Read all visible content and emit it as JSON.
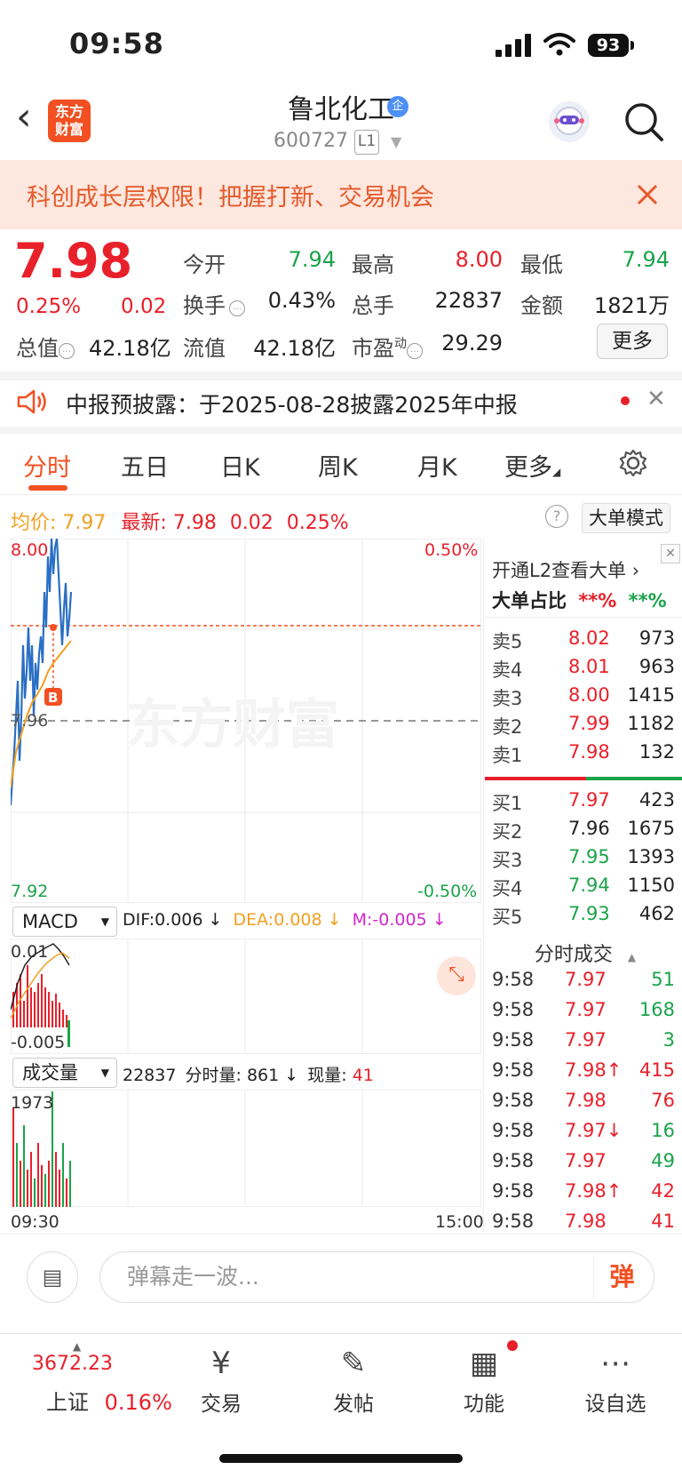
{
  "status_bar": {
    "time": "09:58",
    "battery": "93"
  },
  "header": {
    "logo_text": "东方财富",
    "stock_name": "鲁北化工",
    "badge": "企",
    "stock_code": "600727",
    "level_badge": "L1"
  },
  "banner": {
    "text": "科创成长层权限！把握打新、交易机会"
  },
  "quote": {
    "price": "7.98",
    "change_pct": "0.25%",
    "change": "0.02",
    "labels": {
      "open": "今开",
      "high": "最高",
      "low": "最低",
      "turnover": "换手",
      "volume": "总手",
      "amount": "金额",
      "mkt_cap": "总值",
      "float_cap": "流值",
      "pe": "市盈",
      "pe_sup": "动"
    },
    "values": {
      "open": "7.94",
      "high": "8.00",
      "low": "7.94",
      "turnover": "0.43%",
      "volume": "22837",
      "amount": "1821万",
      "mkt_cap": "42.18亿",
      "float_cap": "42.18亿",
      "pe": "29.29"
    },
    "more_label": "更多"
  },
  "notice": {
    "text": "中报预披露：于2025-08-28披露2025年中报"
  },
  "tabs": [
    "分时",
    "五日",
    "日K",
    "周K",
    "月K",
    "更多"
  ],
  "avg_line": {
    "avg_label": "均价:",
    "avg_value": "7.97",
    "latest_label": "最新:",
    "latest_value": "7.98",
    "change": "0.02",
    "change_pct": "0.25%",
    "mode_button": "大单模式"
  },
  "chart_labels": {
    "y_top": "8.00",
    "y_mid": "7.96",
    "y_bottom": "7.92",
    "pct_top": "0.50%",
    "pct_bottom": "-0.50%",
    "watermark": "东方财富",
    "buy_marker": "B",
    "macd_top": "0.01",
    "macd_bottom": "-0.005",
    "vol_top": "1973",
    "time_start": "09:30",
    "time_end": "15:00"
  },
  "macd": {
    "selector": "MACD",
    "dif": "DIF:0.006 ↓",
    "dea": "DEA:0.008 ↓",
    "m": "M:-0.005 ↓"
  },
  "volume": {
    "selector": "成交量",
    "total": "22837",
    "fenshi_label": "分时量:",
    "fenshi_value": "861 ↓",
    "current_label": "现量:",
    "current_value": "41"
  },
  "orderbook": {
    "promo": "开通L2查看大单 ›",
    "ratio_label": "大单占比",
    "ratio_buy": "**%",
    "ratio_sell": "**%",
    "asks": [
      {
        "label": "卖5",
        "price": "8.02",
        "qty": "973"
      },
      {
        "label": "卖4",
        "price": "8.01",
        "qty": "963"
      },
      {
        "label": "卖3",
        "price": "8.00",
        "qty": "1415"
      },
      {
        "label": "卖2",
        "price": "7.99",
        "qty": "1182"
      },
      {
        "label": "卖1",
        "price": "7.98",
        "qty": "132"
      }
    ],
    "bids": [
      {
        "label": "买1",
        "price": "7.97",
        "qty": "423"
      },
      {
        "label": "买2",
        "price": "7.96",
        "qty": "1675"
      },
      {
        "label": "买3",
        "price": "7.95",
        "qty": "1393"
      },
      {
        "label": "买4",
        "price": "7.94",
        "qty": "1150"
      },
      {
        "label": "买5",
        "price": "7.93",
        "qty": "462"
      }
    ],
    "ticks_title": "分时成交",
    "ticks": [
      {
        "time": "9:58",
        "price": "7.97",
        "vol": "51"
      },
      {
        "time": "9:58",
        "price": "7.97",
        "vol": "168"
      },
      {
        "time": "9:58",
        "price": "7.97",
        "vol": "3"
      },
      {
        "time": "9:58",
        "price": "7.98↑",
        "vol": "415"
      },
      {
        "time": "9:58",
        "price": "7.98",
        "vol": "76"
      },
      {
        "time": "9:58",
        "price": "7.97↓",
        "vol": "16"
      },
      {
        "time": "9:58",
        "price": "7.97",
        "vol": "49"
      },
      {
        "time": "9:58",
        "price": "7.98↑",
        "vol": "42"
      },
      {
        "time": "9:58",
        "price": "7.98",
        "vol": "41"
      }
    ]
  },
  "comment_bar": {
    "placeholder": "弹幕走一波...",
    "danmu_button": "弹"
  },
  "bottom_nav": {
    "index_value": "3672.23",
    "index_name": "上证",
    "index_change": "0.16%",
    "items": [
      "交易",
      "发帖",
      "功能",
      "设自选"
    ]
  },
  "colors": {
    "up": "#e8202a",
    "down": "#1aa34a",
    "accent": "#f25022",
    "avg": "#f0a020",
    "price_line": "#2a6fc4"
  }
}
